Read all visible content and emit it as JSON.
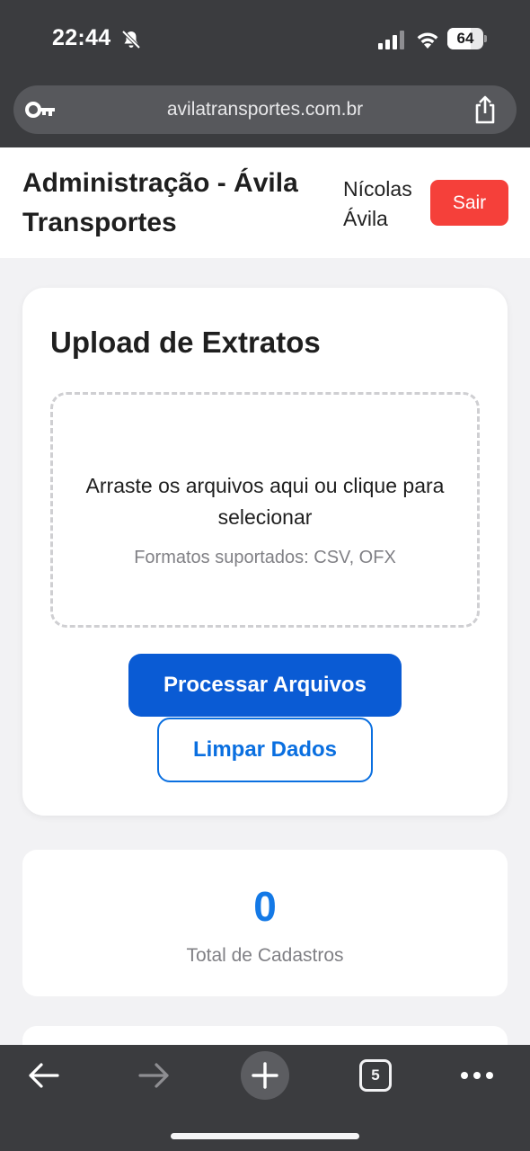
{
  "status_bar": {
    "time": "22:44",
    "battery": "64",
    "battery_level": 0.64
  },
  "browser": {
    "url": "avilatransportes.com.br",
    "open_tabs": "5"
  },
  "header": {
    "title": "Administração - Ávila Transportes",
    "user": "Nícolas Ávila",
    "logout_label": "Sair"
  },
  "upload": {
    "title": "Upload de Extratos",
    "drop_text": "Arraste os arquivos aqui ou clique para selecionar",
    "formats_text": "Formatos suportados: CSV, OFX",
    "process_label": "Processar Arquivos",
    "clear_label": "Limpar Dados"
  },
  "stats": {
    "total_value": "0",
    "total_label": "Total de Cadastros"
  },
  "colors": {
    "primary": "#0a5bd4",
    "accent": "#1479e6",
    "danger": "#f5403a",
    "chrome": "#3b3c3f"
  },
  "icons": [
    "bell-off-icon",
    "signal-icon",
    "wifi-icon",
    "battery-icon",
    "key-icon",
    "share-icon",
    "back-icon",
    "forward-icon",
    "plus-icon",
    "tabs-icon",
    "more-icon"
  ]
}
